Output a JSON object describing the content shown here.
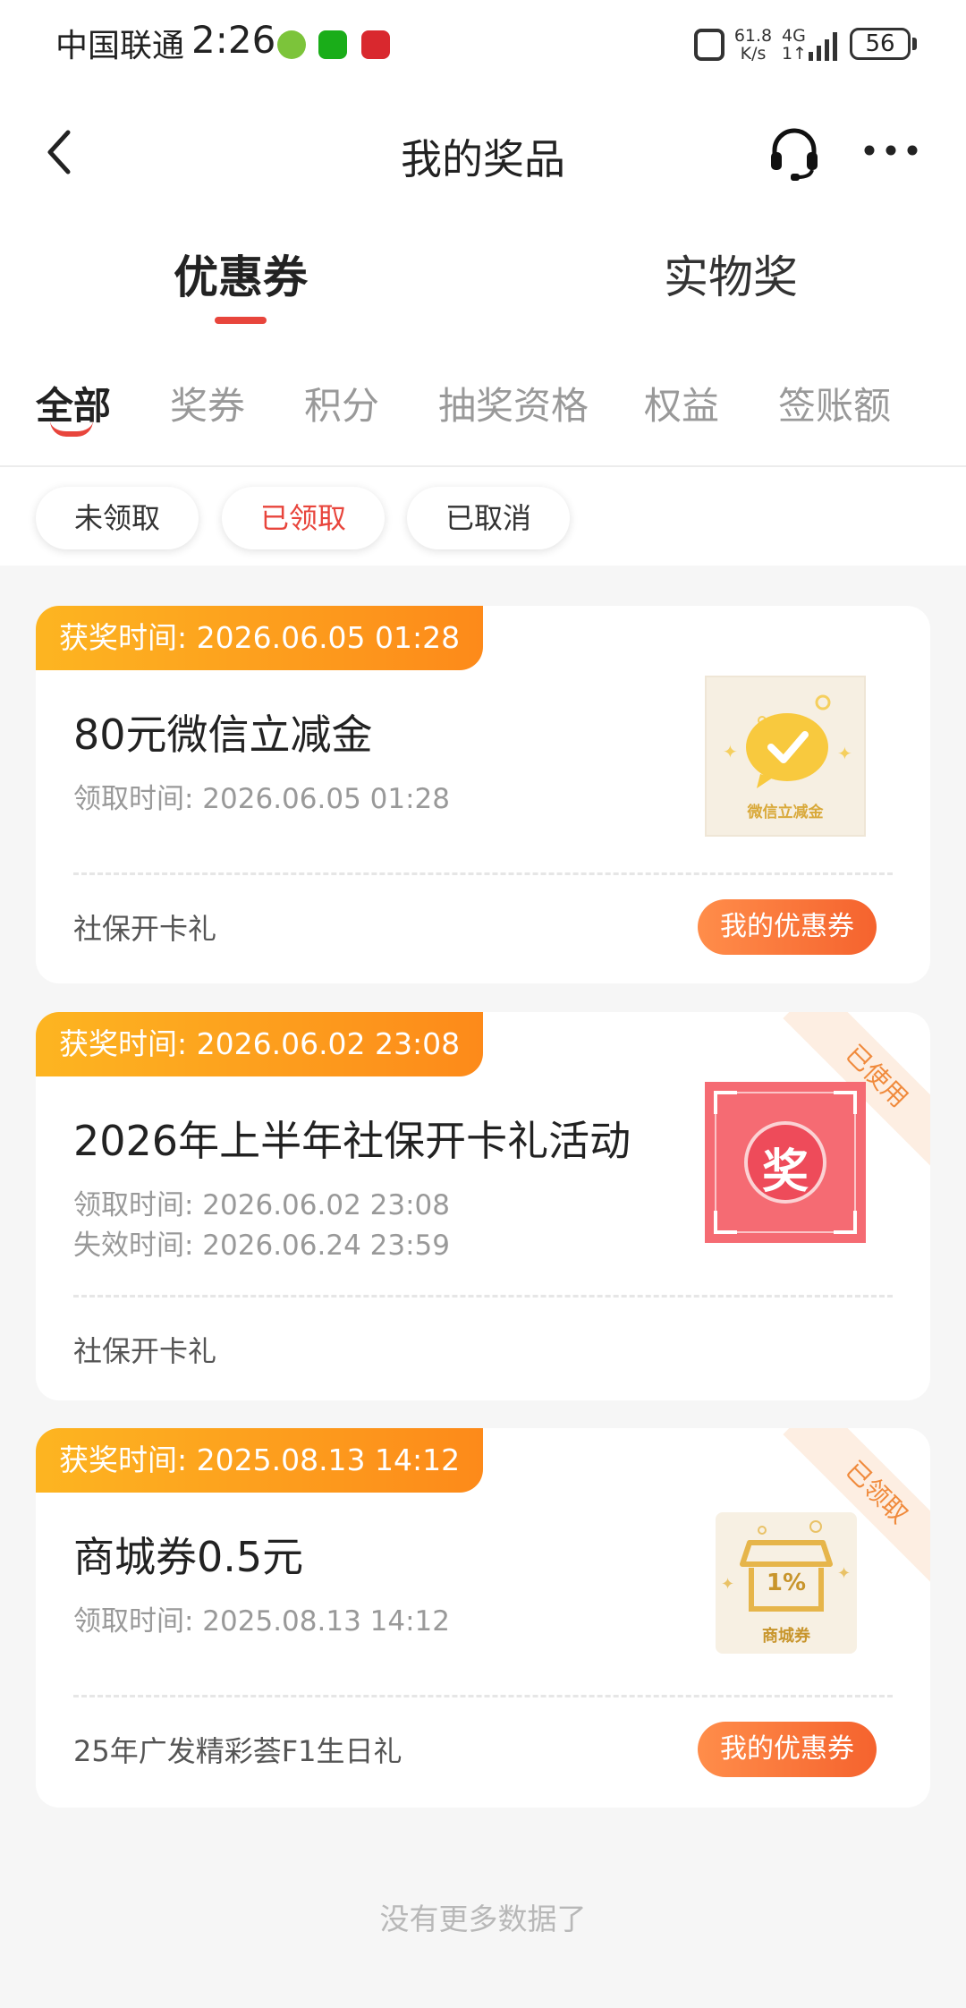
{
  "status_bar": {
    "carrier": "中国联通",
    "time": "2:26",
    "speed_value": "61.8",
    "speed_unit": "K/s",
    "network": "4G",
    "network_sub": "1↑",
    "battery": "56"
  },
  "header": {
    "title": "我的奖品",
    "back_icon": "chevron-left-icon",
    "service_icon": "headset-icon",
    "more_icon": "more-dots-icon"
  },
  "main_tabs": [
    {
      "label": "优惠券",
      "active": true
    },
    {
      "label": "实物奖",
      "active": false
    }
  ],
  "sub_tabs": [
    {
      "label": "全部",
      "active": true
    },
    {
      "label": "奖券",
      "active": false
    },
    {
      "label": "积分",
      "active": false
    },
    {
      "label": "抽奖资格",
      "active": false
    },
    {
      "label": "权益",
      "active": false
    },
    {
      "label": "签账额",
      "active": false
    }
  ],
  "filters": [
    {
      "label": "未领取",
      "active": false
    },
    {
      "label": "已领取",
      "active": true
    },
    {
      "label": "已取消",
      "active": false
    }
  ],
  "cards": [
    {
      "award_time": "获奖时间: 2026.06.05 01:28",
      "title": "80元微信立减金",
      "claim_time": "领取时间: 2026.06.05 01:28",
      "source": "社保开卡礼",
      "button": "我的优惠券",
      "thumb_label": "微信立减金"
    },
    {
      "award_time": "获奖时间: 2026.06.02 23:08",
      "title": "2026年上半年社保开卡礼活动",
      "claim_time": "领取时间: 2026.06.02 23:08",
      "expire_time": "失效时间: 2026.06.24 23:59",
      "source": "社保开卡礼",
      "corner_status": "已使用",
      "thumb_label": "奖"
    },
    {
      "award_time": "获奖时间: 2025.08.13 14:12",
      "title": "商城券0.5元",
      "claim_time": "领取时间: 2025.08.13 14:12",
      "source": "25年广发精彩荟F1生日礼",
      "button": "我的优惠券",
      "corner_status": "已领取",
      "thumb_label": "商城券",
      "thumb_percent": "1%"
    }
  ],
  "footer_text": "没有更多数据了",
  "colors": {
    "accent": "#e8453c",
    "badge_start": "#fdb521",
    "badge_end": "#fd8a1a",
    "button": "#f5632e"
  }
}
